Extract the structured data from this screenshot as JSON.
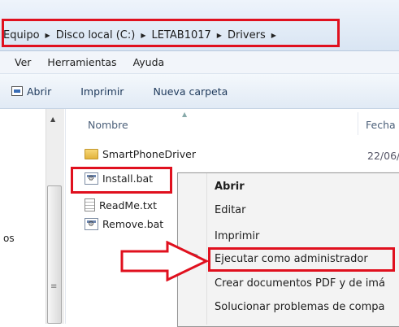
{
  "address": {
    "breadcrumb": [
      "Equipo",
      "Disco local (C:)",
      "LETAB1017",
      "Drivers"
    ]
  },
  "menu": [
    "Ver",
    "Herramientas",
    "Ayuda"
  ],
  "toolbar": {
    "open_label": "Abrir",
    "print_label": "Imprimir",
    "new_folder_label": "Nueva carpeta"
  },
  "nav": {
    "partial_text": "os"
  },
  "columns": {
    "name": "Nombre",
    "date": "Fecha"
  },
  "files": [
    {
      "name": "SmartPhoneDriver",
      "type": "folder",
      "date": "22/06/"
    },
    {
      "name": "Install.bat",
      "type": "bat"
    },
    {
      "name": "ReadMe.txt",
      "type": "txt"
    },
    {
      "name": "Remove.bat",
      "type": "bat"
    }
  ],
  "context_menu": [
    {
      "label": "Abrir",
      "bold": true
    },
    {
      "label": "Editar"
    },
    {
      "label": "Imprimir"
    },
    {
      "label": "Ejecutar como administrador",
      "icon": "uac-shield-icon",
      "highlighted": true
    },
    {
      "label": "Crear documentos PDF y de imá"
    },
    {
      "label": "Solucionar problemas de compa"
    }
  ],
  "colors": {
    "highlight_red": "#e0101e",
    "toolbar_text": "#1e395b"
  }
}
